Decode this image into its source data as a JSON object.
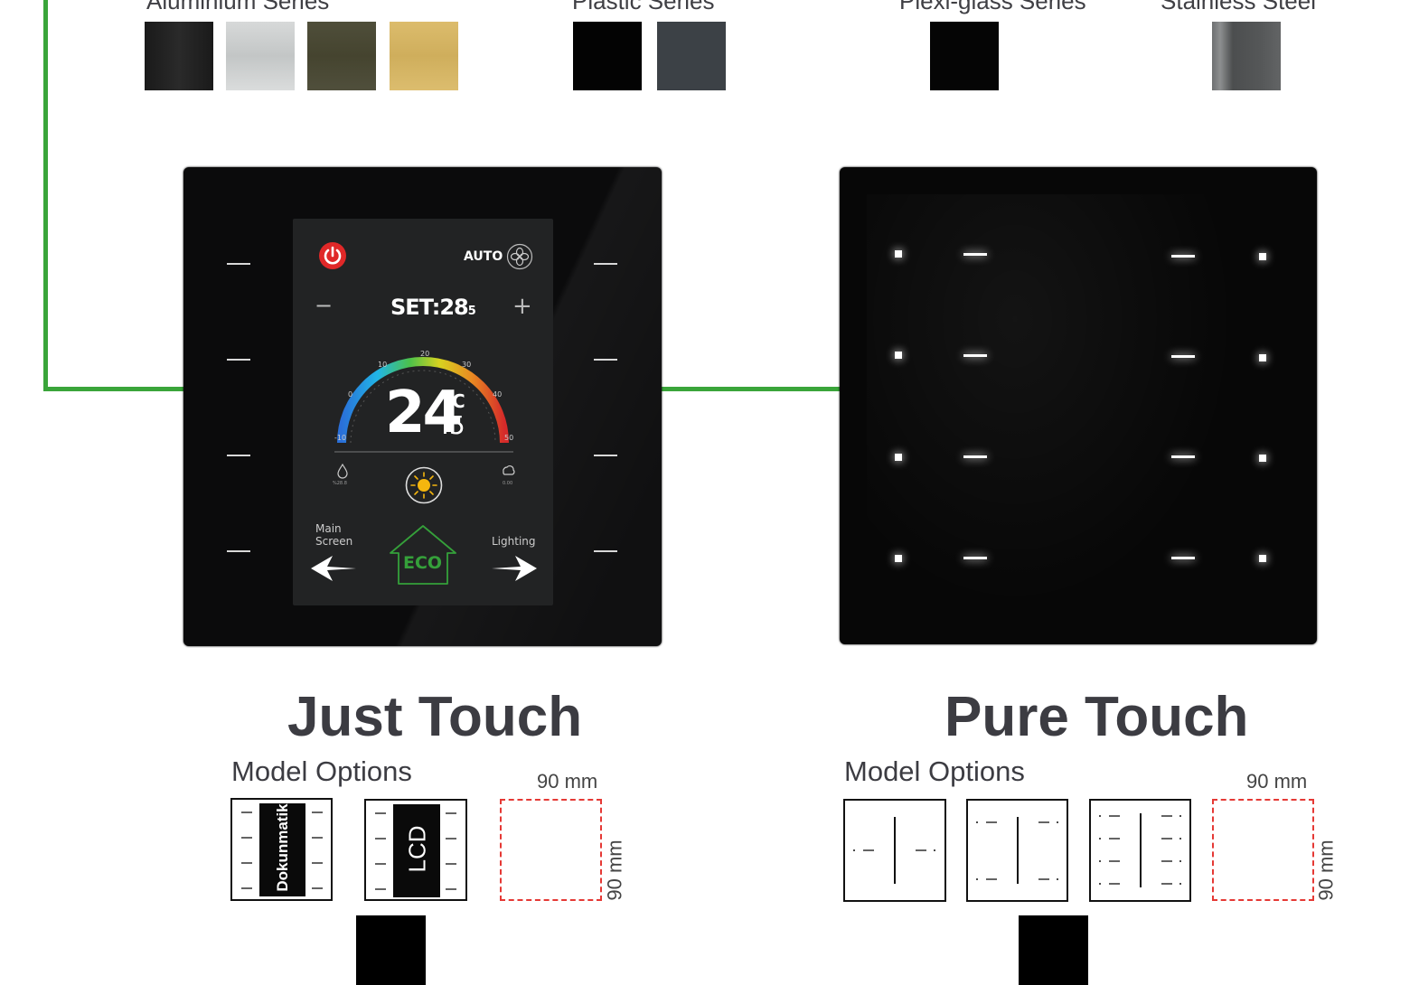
{
  "series": [
    {
      "label": "Aluminium Series",
      "swatches": [
        "#1d1d1d",
        "#cfd1d1",
        "#4b4a38",
        "#d8b766"
      ]
    },
    {
      "label": "Plastic Series",
      "swatches": [
        "#030303",
        "#3c4146"
      ]
    },
    {
      "label": "Plexi-glass Series",
      "swatches": [
        "#050505"
      ]
    },
    {
      "label": "Stainless Steel",
      "swatches": [
        "#5a5c5d"
      ]
    }
  ],
  "wire_color": "#3aa53a",
  "just_touch": {
    "title": "Just Touch",
    "screen": {
      "mode": "AUTO",
      "set_prefix": "SET:",
      "set_value": "28",
      "set_decimal": "5",
      "minus": "−",
      "plus": "+",
      "temp_whole": "24",
      "temp_decimal": ".5",
      "temp_unit": "°C",
      "scale_ticks": [
        "-10",
        "0",
        "10",
        "20",
        "30",
        "40",
        "50"
      ],
      "humidity": "%28.8",
      "co2": "0.00",
      "nav_left": "Main Screen",
      "nav_right": "Lighting",
      "eco": "ECO",
      "power_color": "#e02828",
      "eco_color": "#35a03a"
    },
    "model_options_label": "Model Options",
    "options": [
      "Dokunmatik",
      "LCD"
    ],
    "dim_w": "90 mm",
    "dim_h": "90 mm"
  },
  "pure_touch": {
    "title": "Pure Touch",
    "model_options_label": "Model Options",
    "dim_w": "90 mm",
    "dim_h": "90 mm"
  }
}
